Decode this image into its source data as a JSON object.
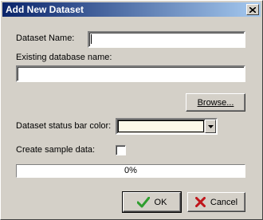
{
  "window": {
    "title": "Add New Dataset",
    "close_icon": "close-x-icon"
  },
  "form": {
    "dataset_name_label": "Dataset Name:",
    "dataset_name_value": "",
    "existing_db_label": "Existing database name:",
    "existing_db_value": "",
    "browse_label": "Browse...",
    "status_color_label": "Dataset status bar color:",
    "status_color_value": "#fdf9e9",
    "sample_data_label": "Create sample data:",
    "sample_data_checked": false
  },
  "progress": {
    "value": 0,
    "text": "0%"
  },
  "buttons": {
    "ok_label": "OK",
    "ok_icon": "checkmark-icon",
    "cancel_label": "Cancel",
    "cancel_icon": "x-mark-icon"
  },
  "colors": {
    "title_gradient_start": "#0a246a",
    "title_gradient_end": "#a6caf0",
    "dialog_face": "#d4d0c8",
    "ok_icon_color": "#2e9e2e",
    "cancel_icon_color": "#c0161b"
  }
}
